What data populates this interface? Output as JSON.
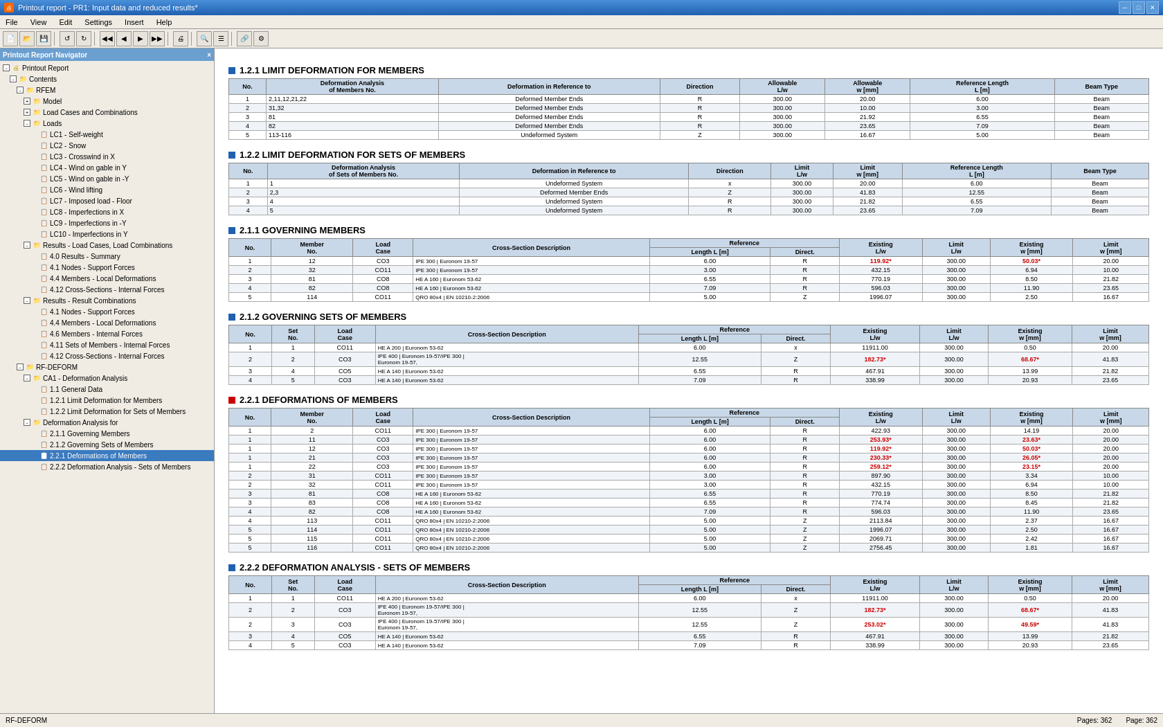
{
  "titleBar": {
    "title": "Printout report - PR1: Input data and reduced results*",
    "icon": "🖨"
  },
  "menuBar": {
    "items": [
      "File",
      "View",
      "Edit",
      "Settings",
      "Insert",
      "Help"
    ]
  },
  "panelHeader": {
    "title": "Printout Report Navigator",
    "closeBtn": "×"
  },
  "tree": [
    {
      "level": 0,
      "label": "Printout Report",
      "type": "root",
      "expanded": true
    },
    {
      "level": 1,
      "label": "Contents",
      "type": "folder",
      "expanded": true
    },
    {
      "level": 2,
      "label": "RFEM",
      "type": "folder",
      "expanded": true
    },
    {
      "level": 3,
      "label": "Model",
      "type": "folder",
      "expanded": false
    },
    {
      "level": 3,
      "label": "Load Cases and Combinations",
      "type": "folder",
      "expanded": false
    },
    {
      "level": 3,
      "label": "Loads",
      "type": "folder",
      "expanded": true
    },
    {
      "level": 4,
      "label": "LC1 - Self-weight",
      "type": "doc"
    },
    {
      "level": 4,
      "label": "LC2 - Snow",
      "type": "doc"
    },
    {
      "level": 4,
      "label": "LC3 - Crosswind in X",
      "type": "doc"
    },
    {
      "level": 4,
      "label": "LC4 - Wind on gable in Y",
      "type": "doc"
    },
    {
      "level": 4,
      "label": "LC5 - Wind on gable in -Y",
      "type": "doc"
    },
    {
      "level": 4,
      "label": "LC6 - Wind lifting",
      "type": "doc"
    },
    {
      "level": 4,
      "label": "LC7 - Imposed load - Floor",
      "type": "doc"
    },
    {
      "level": 4,
      "label": "LC8 - Imperfections in X",
      "type": "doc"
    },
    {
      "level": 4,
      "label": "LC9 - Imperfections in -Y",
      "type": "doc"
    },
    {
      "level": 4,
      "label": "LC10 - Imperfections in Y",
      "type": "doc"
    },
    {
      "level": 3,
      "label": "Results - Load Cases, Load Combinations",
      "type": "folder",
      "expanded": true
    },
    {
      "level": 4,
      "label": "4.0 Results - Summary",
      "type": "doc"
    },
    {
      "level": 4,
      "label": "4.1 Nodes - Support Forces",
      "type": "doc"
    },
    {
      "level": 4,
      "label": "4.4 Members - Local Deformations",
      "type": "doc"
    },
    {
      "level": 4,
      "label": "4.12 Cross-Sections - Internal Forces",
      "type": "doc"
    },
    {
      "level": 3,
      "label": "Results - Result Combinations",
      "type": "folder",
      "expanded": true
    },
    {
      "level": 4,
      "label": "4.1 Nodes - Support Forces",
      "type": "doc"
    },
    {
      "level": 4,
      "label": "4.4 Members - Local Deformations",
      "type": "doc"
    },
    {
      "level": 4,
      "label": "4.6 Members - Internal Forces",
      "type": "doc"
    },
    {
      "level": 4,
      "label": "4.11 Sets of Members - Internal Forces",
      "type": "doc"
    },
    {
      "level": 4,
      "label": "4.12 Cross-Sections - Internal Forces",
      "type": "doc"
    },
    {
      "level": 2,
      "label": "RF-DEFORM",
      "type": "folder",
      "expanded": true
    },
    {
      "level": 3,
      "label": "CA1 - Deformation Analysis",
      "type": "folder",
      "expanded": true
    },
    {
      "level": 4,
      "label": "1.1 General Data",
      "type": "doc"
    },
    {
      "level": 4,
      "label": "1.2.1 Limit Deformation for Members",
      "type": "doc"
    },
    {
      "level": 4,
      "label": "1.2.2 Limit Deformation for Sets of Members",
      "type": "doc"
    },
    {
      "level": 3,
      "label": "Deformation Analysis for",
      "type": "folder",
      "expanded": true
    },
    {
      "level": 4,
      "label": "2.1.1 Governing Members",
      "type": "doc"
    },
    {
      "level": 4,
      "label": "2.1.2 Governing Sets of Members",
      "type": "doc"
    },
    {
      "level": 4,
      "label": "2.2.1 Deformations of Members",
      "type": "doc",
      "selected": true
    },
    {
      "level": 4,
      "label": "2.2.2 Deformation Analysis - Sets of Members",
      "type": "doc"
    }
  ],
  "sections": {
    "s121": {
      "heading": "1.2.1 LIMIT DEFORMATION FOR MEMBERS",
      "columns": [
        "No.",
        "Deformation Analysis\nof Members No.",
        "Deformation in Reference to",
        "Direction",
        "Allowable\nL/w",
        "Allowable\nw [mm]",
        "Reference Length\nL [m]",
        "Beam Type"
      ],
      "rows": [
        [
          "1",
          "2,11,12,21,22",
          "Deformed Member Ends",
          "R",
          "300.00",
          "20.00",
          "6.00",
          "Beam"
        ],
        [
          "2",
          "31,32",
          "Deformed Member Ends",
          "R",
          "300.00",
          "10.00",
          "3.00",
          "Beam"
        ],
        [
          "3",
          "81",
          "Deformed Member Ends",
          "R",
          "300.00",
          "21.92",
          "6.55",
          "Beam"
        ],
        [
          "4",
          "82",
          "Deformed Member Ends",
          "R",
          "300.00",
          "23.65",
          "7.09",
          "Beam"
        ],
        [
          "5",
          "113-116",
          "Undeformed System",
          "Z",
          "300.00",
          "16.67",
          "5.00",
          "Beam"
        ]
      ]
    },
    "s122": {
      "heading": "1.2.2 LIMIT DEFORMATION FOR SETS OF MEMBERS",
      "columns": [
        "No.",
        "Deformation Analysis\nof Sets of Members No.",
        "Deformation in Reference to",
        "Direction",
        "Limit\nL/w",
        "Limit\nw [mm]",
        "Reference Length\nL [m]",
        "Beam Type"
      ],
      "rows": [
        [
          "1",
          "1",
          "Undeformed System",
          "x",
          "300.00",
          "20.00",
          "6.00",
          "Beam"
        ],
        [
          "2",
          "2,3",
          "Deformed Member Ends",
          "Z",
          "300.00",
          "41.83",
          "12.55",
          "Beam"
        ],
        [
          "3",
          "4",
          "Undeformed System",
          "R",
          "300.00",
          "21.82",
          "6.55",
          "Beam"
        ],
        [
          "4",
          "5",
          "Undeformed System",
          "R",
          "300.00",
          "23.65",
          "7.09",
          "Beam"
        ]
      ]
    },
    "s211": {
      "heading": "2.1.1 GOVERNING MEMBERS",
      "columns": [
        "No.",
        "Member\nNo.",
        "Load\nCase",
        "Cross-Section Description",
        "Reference\nLength L [m]",
        "Direct.",
        "Existing\nL/w",
        "Limit\nL/w",
        "Existing\nw [mm]",
        "Limit\nw [mm]"
      ],
      "rows": [
        [
          "1",
          "12",
          "CO3",
          "IPE 300 | Euronom 19-57",
          "6.00",
          "R",
          "119.92*",
          "300.00",
          "50.03*",
          "20.00"
        ],
        [
          "2",
          "32",
          "CO11",
          "IPE 300 | Euronom 19-57",
          "3.00",
          "R",
          "432.15",
          "300.00",
          "6.94",
          "10.00"
        ],
        [
          "3",
          "81",
          "CO8",
          "HE A 160 | Euronom 53-62",
          "6.55",
          "R",
          "770.19",
          "300.00",
          "8.50",
          "21.82"
        ],
        [
          "4",
          "82",
          "CO8",
          "HE A 160 | Euronom 53-62",
          "7.09",
          "R",
          "596.03",
          "300.00",
          "11.90",
          "23.65"
        ],
        [
          "5",
          "114",
          "CO11",
          "QRO 80x4 | EN 10210-2:2006",
          "5.00",
          "Z",
          "1996.07",
          "300.00",
          "2.50",
          "16.67"
        ]
      ]
    },
    "s212": {
      "heading": "2.1.2 GOVERNING SETS OF MEMBERS",
      "columns": [
        "No.",
        "Set\nNo.",
        "Load\nCase",
        "Cross-Section Description",
        "Reference\nLength L [m]",
        "Direct.",
        "Existing\nL/w",
        "Limit\nL/w",
        "Existing\nw [mm]",
        "Limit\nw [mm]"
      ],
      "rows": [
        [
          "1",
          "1",
          "CO11",
          "HE A 200 | Euronom 53-62",
          "6.00",
          "x",
          "11911.00",
          "300.00",
          "0.50",
          "20.00"
        ],
        [
          "2",
          "2",
          "CO3",
          "IPE 400 | Euronom 19-57/IPE 300 |\nEuronom 19-57,",
          "12.55",
          "Z",
          "182.73*",
          "300.00",
          "68.67*",
          "41.83"
        ],
        [
          "3",
          "4",
          "CO5",
          "HE A 140 | Euronom 53-62",
          "6.55",
          "R",
          "467.91",
          "300.00",
          "13.99",
          "21.82"
        ],
        [
          "4",
          "5",
          "CO3",
          "HE A 140 | Euronom 53-62",
          "7.09",
          "R",
          "338.99",
          "300.00",
          "20.93",
          "23.65"
        ]
      ]
    },
    "s221": {
      "heading": "2.2.1 DEFORMATIONS OF MEMBERS",
      "isRed": true,
      "columns": [
        "No.",
        "Member\nNo.",
        "Load\nCase",
        "Cross-Section Description",
        "Reference\nLength L [m]",
        "Direct.",
        "Existing\nL/w",
        "Limit\nL/w",
        "Existing\nw [mm]",
        "Limit\nw [mm]"
      ],
      "rows": [
        [
          "1",
          "2",
          "CO11",
          "IPE 300 | Euronom 19-57",
          "6.00",
          "R",
          "422.93",
          "300.00",
          "14.19",
          "20.00"
        ],
        [
          "1",
          "11",
          "CO3",
          "IPE 300 | Euronom 19-57",
          "6.00",
          "R",
          "253.93*",
          "300.00",
          "23.63*",
          "20.00"
        ],
        [
          "1",
          "12",
          "CO3",
          "IPE 300 | Euronom 19-57",
          "6.00",
          "R",
          "119.92*",
          "300.00",
          "50.03*",
          "20.00"
        ],
        [
          "1",
          "21",
          "CO3",
          "IPE 300 | Euronom 19-57",
          "6.00",
          "R",
          "230.33*",
          "300.00",
          "26.05*",
          "20.00"
        ],
        [
          "1",
          "22",
          "CO3",
          "IPE 300 | Euronom 19-57",
          "6.00",
          "R",
          "259.12*",
          "300.00",
          "23.15*",
          "20.00"
        ],
        [
          "2",
          "31",
          "CO11",
          "IPE 300 | Euronom 19-57",
          "3.00",
          "R",
          "897.90",
          "300.00",
          "3.34",
          "10.00"
        ],
        [
          "2",
          "32",
          "CO11",
          "IPE 300 | Euronom 19-57",
          "3.00",
          "R",
          "432.15",
          "300.00",
          "6.94",
          "10.00"
        ],
        [
          "3",
          "81",
          "CO8",
          "HE A 160 | Euronom 53-62",
          "6.55",
          "R",
          "770.19",
          "300.00",
          "8.50",
          "21.82"
        ],
        [
          "3",
          "83",
          "CO8",
          "HE A 160 | Euronom 53-62",
          "6.55",
          "R",
          "774.74",
          "300.00",
          "8.45",
          "21.82"
        ],
        [
          "4",
          "82",
          "CO8",
          "HE A 160 | Euronom 53-62",
          "7.09",
          "R",
          "596.03",
          "300.00",
          "11.90",
          "23.65"
        ],
        [
          "4",
          "113",
          "CO11",
          "QRO 80x4 | EN 10210-2:2006",
          "5.00",
          "Z",
          "2113.84",
          "300.00",
          "2.37",
          "16.67"
        ],
        [
          "5",
          "114",
          "CO11",
          "QRO 80x4 | EN 10210-2:2006",
          "5.00",
          "Z",
          "1996.07",
          "300.00",
          "2.50",
          "16.67"
        ],
        [
          "5",
          "115",
          "CO11",
          "QRO 80x4 | EN 10210-2:2006",
          "5.00",
          "Z",
          "2069.71",
          "300.00",
          "2.42",
          "16.67"
        ],
        [
          "5",
          "116",
          "CO11",
          "QRO 80x4 | EN 10210-2:2006",
          "5.00",
          "Z",
          "2756.45",
          "300.00",
          "1.81",
          "16.67"
        ]
      ]
    },
    "s222": {
      "heading": "2.2.2 DEFORMATION ANALYSIS - SETS OF MEMBERS",
      "columns": [
        "No.",
        "Set\nNo.",
        "Load\nCase",
        "Cross-Section Description",
        "Reference\nLength L [m]",
        "Direct.",
        "Existing\nL/w",
        "Limit\nL/w",
        "Existing\nw [mm]",
        "Limit\nw [mm]"
      ],
      "rows": [
        [
          "1",
          "1",
          "CO11",
          "HE A 200 | Euronom 53-62",
          "6.00",
          "x",
          "11911.00",
          "300.00",
          "0.50",
          "20.00"
        ],
        [
          "2",
          "2",
          "CO3",
          "IPE 400 | Euronom 19-57/IPE 300 |\nEuronom 19-57,",
          "12.55",
          "Z",
          "182.73*",
          "300.00",
          "68.67*",
          "41.83"
        ],
        [
          "2",
          "3",
          "CO3",
          "IPE 400 | Euronom 19-57/IPE 300 |\nEuronom 19-57,",
          "12.55",
          "Z",
          "253.02*",
          "300.00",
          "49.59*",
          "41.83"
        ],
        [
          "3",
          "4",
          "CO5",
          "HE A 140 | Euronom 53-62",
          "6.55",
          "R",
          "467.91",
          "300.00",
          "13.99",
          "21.82"
        ],
        [
          "4",
          "5",
          "CO3",
          "HE A 140 | Euronom 53-62",
          "7.09",
          "R",
          "338.99",
          "300.00",
          "20.93",
          "23.65"
        ]
      ]
    }
  },
  "statusBar": {
    "left": "RF-DEFORM",
    "middle": "",
    "pages": "Pages: 362",
    "page": "Page: 362"
  }
}
